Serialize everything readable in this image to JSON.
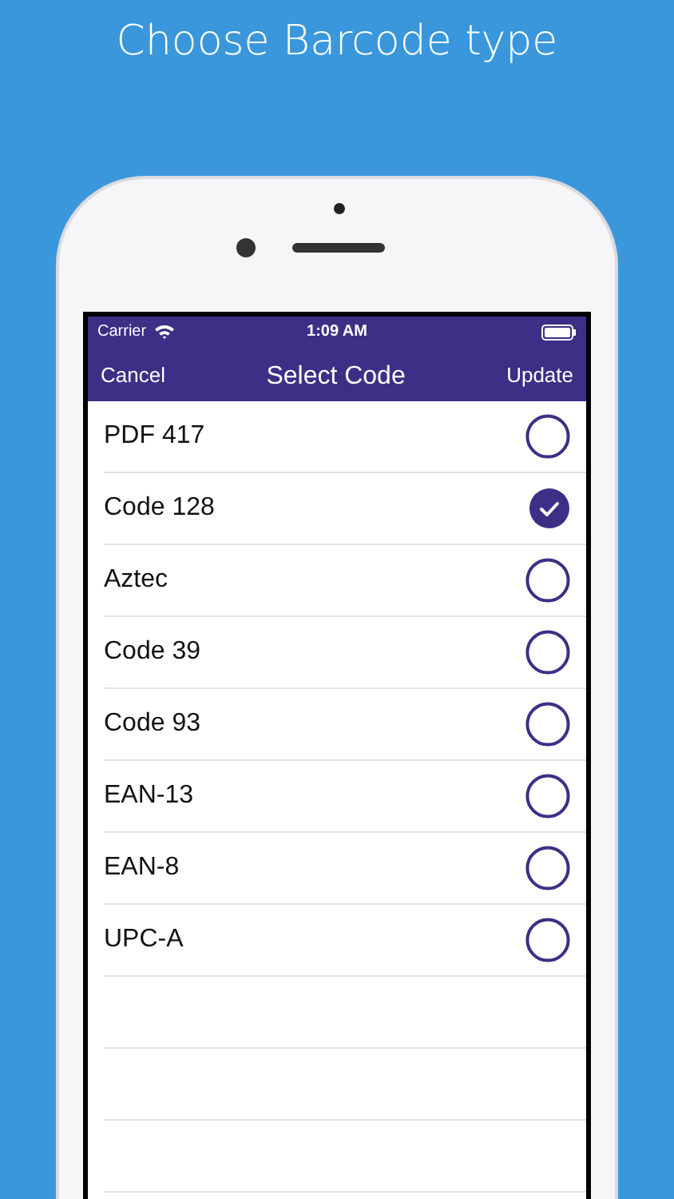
{
  "headline": "Choose Barcode type",
  "status_bar": {
    "carrier": "Carrier",
    "time": "1:09 AM"
  },
  "nav_bar": {
    "left": "Cancel",
    "title": "Select Code",
    "right": "Update"
  },
  "options": [
    {
      "label": "PDF 417",
      "selected": false
    },
    {
      "label": "Code 128",
      "selected": true
    },
    {
      "label": "Aztec",
      "selected": false
    },
    {
      "label": "Code 39",
      "selected": false
    },
    {
      "label": "Code 93",
      "selected": false
    },
    {
      "label": "EAN-13",
      "selected": false
    },
    {
      "label": "EAN-8",
      "selected": false
    },
    {
      "label": "UPC-A",
      "selected": false
    }
  ]
}
